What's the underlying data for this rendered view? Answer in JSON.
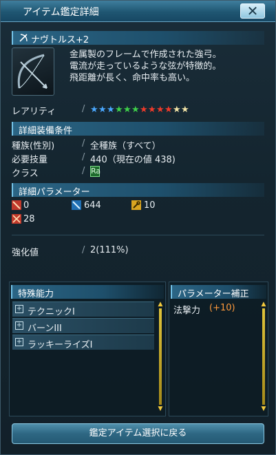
{
  "window": {
    "title": "アイテム鑑定詳細",
    "close_symbol": "✕"
  },
  "item": {
    "name": "ナヴトルス+2",
    "description": [
      "金属製のフレームで作成された強弓。",
      "電流が走っているような弦が特徴的。",
      "飛距離が長く、命中率も高い。"
    ],
    "icon": "bow-icon",
    "type_icon": "bow-type-icon"
  },
  "rarity": {
    "label": "レアリティ",
    "stars": 12,
    "star_colors": [
      "#4aa8ff",
      "#4aa8ff",
      "#4aa8ff",
      "#3fd24a",
      "#3fd24a",
      "#3fd24a",
      "#ef3a2a",
      "#ef3a2a",
      "#ef3a2a",
      "#ef3a2a",
      "#f5e6a8",
      "#f5e6a8"
    ]
  },
  "requirements": {
    "header": "詳細装備条件",
    "race_label": "種族(性別)",
    "race_value": "全種族（すべて）",
    "skill_label": "必要技量",
    "skill_value": "440（現在の値 438)",
    "class_label": "クラス",
    "class_icon": "ranger-class-icon"
  },
  "parameters": {
    "header": "詳細パラメーター",
    "values": [
      {
        "icon": "sword-attack-icon",
        "value": "0"
      },
      {
        "icon": "ranged-attack-icon",
        "value": "644"
      },
      {
        "icon": "wrench-icon",
        "value": "10"
      },
      {
        "icon": "technique-attack-icon",
        "value": "28"
      }
    ]
  },
  "enhance": {
    "label": "強化値",
    "value": "2(111%)"
  },
  "special": {
    "header": "特殊能力",
    "items": [
      "テクニックI",
      "バーンIII",
      "ラッキーライズI"
    ]
  },
  "param_bonus": {
    "header": "パラメーター補正",
    "label": "法撃力",
    "value": "(+10)"
  },
  "return_button": "鑑定アイテム選択に戻る",
  "colors": {
    "accent": "#75c3e8",
    "bonus_orange": "#ff9a3c",
    "title_bar": "#1f5672"
  }
}
